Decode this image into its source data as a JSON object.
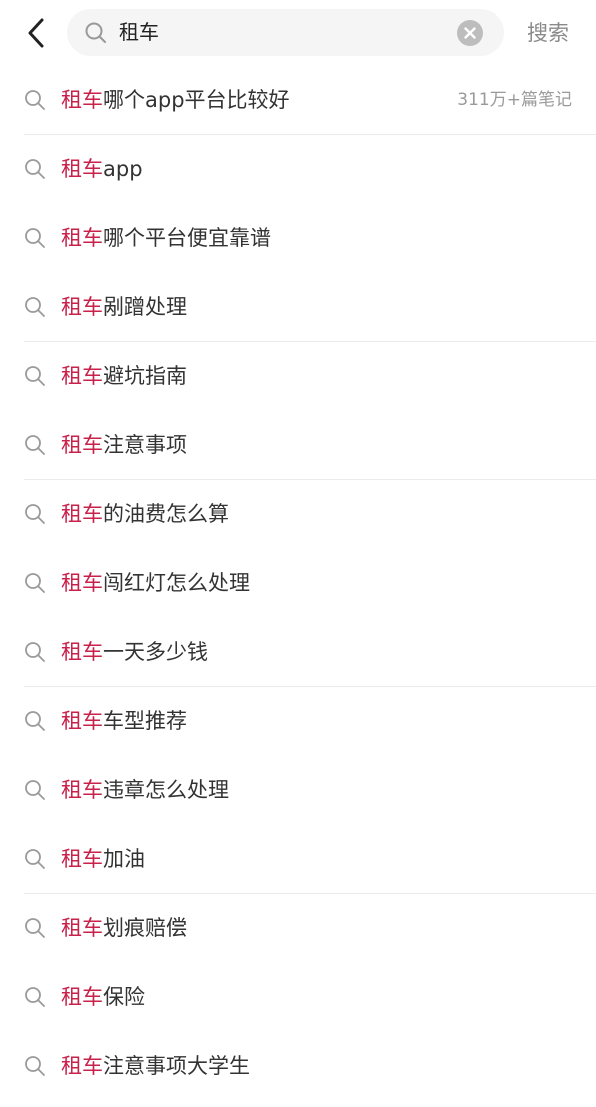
{
  "search": {
    "query": "租车",
    "button_label": "搜索"
  },
  "suggestions": [
    {
      "highlight": "租车",
      "rest": "哪个app平台比较好",
      "count": "311万+篇笔记"
    },
    {
      "highlight": "租车",
      "rest": "app"
    },
    {
      "highlight": "租车",
      "rest": "哪个平台便宜靠谱"
    },
    {
      "highlight": "租车",
      "rest": "剐蹭处理"
    },
    {
      "highlight": "租车",
      "rest": "避坑指南"
    },
    {
      "highlight": "租车",
      "rest": "注意事项"
    },
    {
      "highlight": "租车",
      "rest": "的油费怎么算"
    },
    {
      "highlight": "租车",
      "rest": "闯红灯怎么处理"
    },
    {
      "highlight": "租车",
      "rest": "一天多少钱"
    },
    {
      "highlight": "租车",
      "rest": "车型推荐"
    },
    {
      "highlight": "租车",
      "rest": "违章怎么处理"
    },
    {
      "highlight": "租车",
      "rest": "加油"
    },
    {
      "highlight": "租车",
      "rest": "划痕赔偿"
    },
    {
      "highlight": "租车",
      "rest": "保险"
    },
    {
      "highlight": "租车",
      "rest": "注意事项大学生"
    }
  ],
  "colors": {
    "highlight": "#c8214a",
    "text": "#333333",
    "muted": "#9a9a9a",
    "search_bg": "#f5f5f5"
  },
  "icons": {
    "back": "chevron-left-icon",
    "search": "search-icon",
    "clear": "close-circle-icon",
    "row": "search-icon"
  }
}
